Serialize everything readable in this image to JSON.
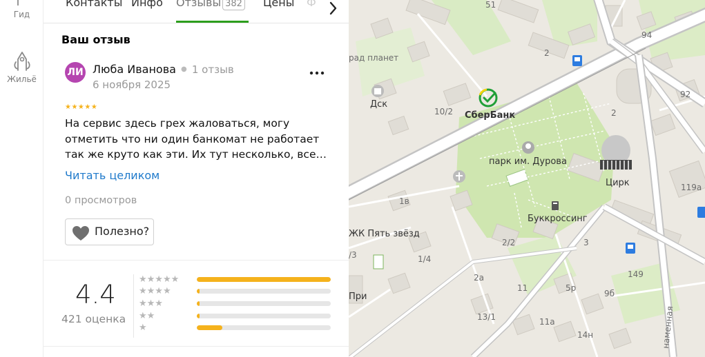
{
  "rail": {
    "items": [
      {
        "label": "Гид",
        "icon": "flag-icon"
      },
      {
        "label": "Жильё",
        "icon": "house-icon"
      }
    ]
  },
  "tabs": {
    "items": [
      "Контакты",
      "Инфо",
      "Отзывы",
      "Цены",
      "Ф"
    ],
    "active": "Отзывы",
    "reviews_badge": "382"
  },
  "review": {
    "section_title": "Ваш отзыв",
    "avatar_initials": "ЛИ",
    "avatar_color": "#b545b0",
    "author": "Люба Иванова",
    "reviews_count": "1 отзыв",
    "date": "6 ноября 2025",
    "stars": "★★★★★",
    "text_lines": [
      "На сервис здесь грех жаловаться, могу",
      "отметить что ни один банкомат не работает",
      "так же круто как эти. Их тут несколько, все…"
    ],
    "read_more": "Читать целиком",
    "views": "0 просмотров",
    "useful_label": "Полезно?"
  },
  "rating": {
    "value": "4.4",
    "count": "421 оценка",
    "histogram": [
      {
        "stars": "★★★★★",
        "fraction": 1.0
      },
      {
        "stars": "★★★★",
        "fraction": 0.02
      },
      {
        "stars": "★★★",
        "fraction": 0.02
      },
      {
        "stars": "★★",
        "fraction": 0.02
      },
      {
        "stars": "★",
        "fraction": 0.19
      }
    ],
    "accent_color": "#f5b21c"
  },
  "map": {
    "labels": {
      "l51": "51",
      "l94": "94",
      "l92": "92",
      "l2a": "2",
      "l2b": "2",
      "lplanet": "рад планет",
      "ldsk": "Дск",
      "l102": "10/2",
      "lsber": "СберБанк",
      "lpark": "парк им. Дурова",
      "lcirk": "Цирк",
      "l119a": "119а",
      "l1v": "1в",
      "lbook": "Буккроссинг",
      "lzhk": "ЖК Пять звёзд",
      "l3": "/3",
      "l14": "1/4",
      "l22": "2/2",
      "l3b": "3",
      "l149": "149",
      "l2a2": "2а",
      "l11": "11",
      "l5r": "5р",
      "l9b": "9б",
      "lpri": "При",
      "l131": "13/1",
      "l11a": "11а",
      "l14n": "14н",
      "lstreet": "наменная"
    }
  }
}
